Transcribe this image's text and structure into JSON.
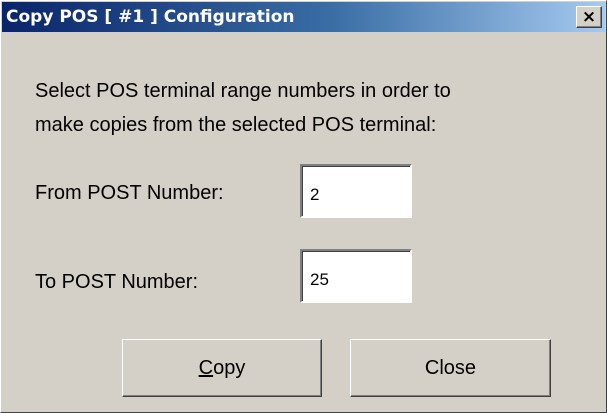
{
  "window": {
    "title": "Copy POS [ #1 ] Configuration",
    "close_glyph": "×"
  },
  "instruction": {
    "line1": "Select POS terminal range numbers in order to",
    "line2": "make copies from the selected POS terminal:"
  },
  "fields": {
    "from": {
      "label": "From POST Number:",
      "value": "2"
    },
    "to": {
      "label": "To POST Number:",
      "value": "25"
    }
  },
  "buttons": {
    "copy": {
      "mnemonic": "C",
      "rest": "opy"
    },
    "close": {
      "label": "Close"
    }
  },
  "colors": {
    "face": "#d4d0c8",
    "title_start": "#0a246a",
    "title_end": "#a6caf0",
    "title_text": "#ffffff"
  },
  "icons": {
    "close": "close-icon"
  }
}
